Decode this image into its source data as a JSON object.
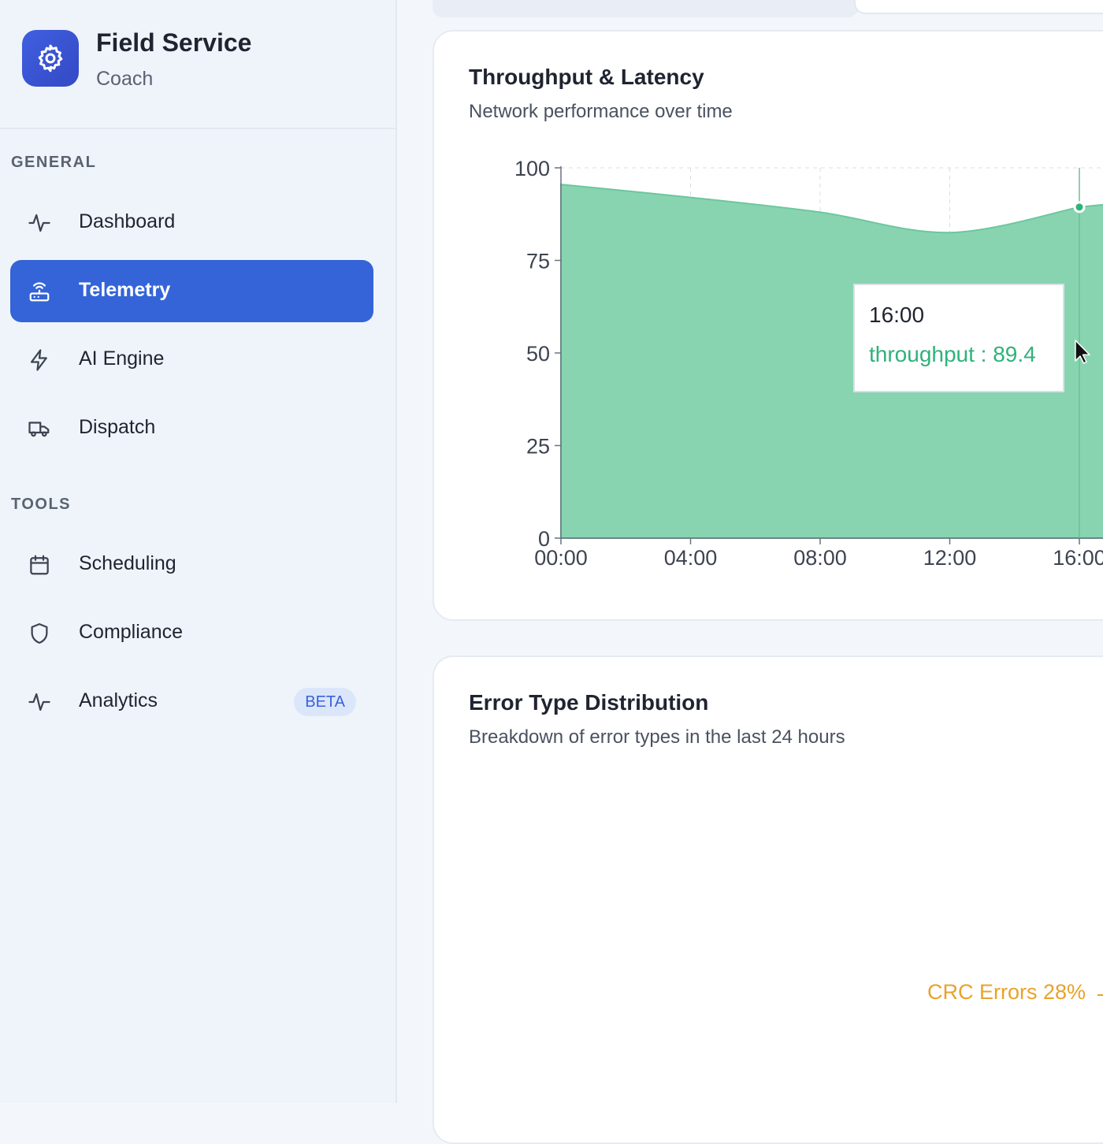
{
  "app": {
    "title": "Field Service",
    "subtitle": "Coach",
    "logo_icon": "gear-icon",
    "accent_color": "#3464d8"
  },
  "sidebar": {
    "sections": [
      {
        "label": "GENERAL",
        "items": [
          {
            "label": "Dashboard",
            "icon": "activity-icon",
            "active": false
          },
          {
            "label": "Telemetry",
            "icon": "router-icon",
            "active": true
          },
          {
            "label": "AI Engine",
            "icon": "lightning-icon",
            "active": false
          },
          {
            "label": "Dispatch",
            "icon": "truck-icon",
            "active": false
          }
        ]
      },
      {
        "label": "TOOLS",
        "items": [
          {
            "label": "Scheduling",
            "icon": "calendar-icon",
            "active": false
          },
          {
            "label": "Compliance",
            "icon": "shield-icon",
            "active": false
          },
          {
            "label": "Analytics",
            "icon": "activity-icon",
            "active": false,
            "badge": "BETA"
          }
        ]
      }
    ]
  },
  "throughput_card": {
    "title": "Throughput & Latency",
    "subtitle": "Network performance over time",
    "tooltip": {
      "label": "16:00",
      "series": "throughput",
      "value": "89.4"
    }
  },
  "error_card": {
    "title": "Error Type Distribution",
    "subtitle": "Breakdown of error types in the last 24 hours",
    "visible_label": "CRC Errors 28%"
  },
  "chart_data": {
    "type": "area",
    "x": [
      "00:00",
      "04:00",
      "08:00",
      "12:00",
      "16:00"
    ],
    "series": [
      {
        "name": "throughput",
        "color": "#88d4b1",
        "values": [
          95.5,
          92,
          88,
          82.5,
          89.4
        ]
      }
    ],
    "yticks": [
      0,
      25,
      50,
      75,
      100
    ],
    "ylim": [
      0,
      100
    ],
    "grid": true,
    "highlight_index": 4
  }
}
